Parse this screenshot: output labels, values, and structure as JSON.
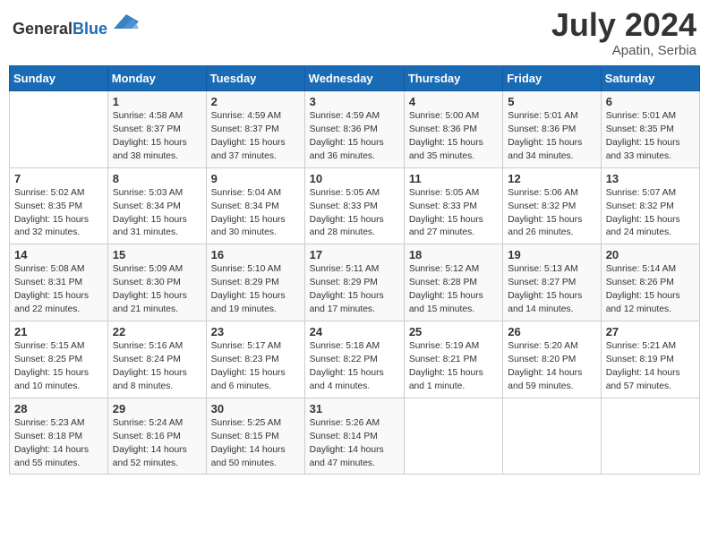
{
  "header": {
    "logo_general": "General",
    "logo_blue": "Blue",
    "month_year": "July 2024",
    "location": "Apatin, Serbia"
  },
  "days_of_week": [
    "Sunday",
    "Monday",
    "Tuesday",
    "Wednesday",
    "Thursday",
    "Friday",
    "Saturday"
  ],
  "weeks": [
    [
      {
        "day": "",
        "info": ""
      },
      {
        "day": "1",
        "info": "Sunrise: 4:58 AM\nSunset: 8:37 PM\nDaylight: 15 hours\nand 38 minutes."
      },
      {
        "day": "2",
        "info": "Sunrise: 4:59 AM\nSunset: 8:37 PM\nDaylight: 15 hours\nand 37 minutes."
      },
      {
        "day": "3",
        "info": "Sunrise: 4:59 AM\nSunset: 8:36 PM\nDaylight: 15 hours\nand 36 minutes."
      },
      {
        "day": "4",
        "info": "Sunrise: 5:00 AM\nSunset: 8:36 PM\nDaylight: 15 hours\nand 35 minutes."
      },
      {
        "day": "5",
        "info": "Sunrise: 5:01 AM\nSunset: 8:36 PM\nDaylight: 15 hours\nand 34 minutes."
      },
      {
        "day": "6",
        "info": "Sunrise: 5:01 AM\nSunset: 8:35 PM\nDaylight: 15 hours\nand 33 minutes."
      }
    ],
    [
      {
        "day": "7",
        "info": "Sunrise: 5:02 AM\nSunset: 8:35 PM\nDaylight: 15 hours\nand 32 minutes."
      },
      {
        "day": "8",
        "info": "Sunrise: 5:03 AM\nSunset: 8:34 PM\nDaylight: 15 hours\nand 31 minutes."
      },
      {
        "day": "9",
        "info": "Sunrise: 5:04 AM\nSunset: 8:34 PM\nDaylight: 15 hours\nand 30 minutes."
      },
      {
        "day": "10",
        "info": "Sunrise: 5:05 AM\nSunset: 8:33 PM\nDaylight: 15 hours\nand 28 minutes."
      },
      {
        "day": "11",
        "info": "Sunrise: 5:05 AM\nSunset: 8:33 PM\nDaylight: 15 hours\nand 27 minutes."
      },
      {
        "day": "12",
        "info": "Sunrise: 5:06 AM\nSunset: 8:32 PM\nDaylight: 15 hours\nand 26 minutes."
      },
      {
        "day": "13",
        "info": "Sunrise: 5:07 AM\nSunset: 8:32 PM\nDaylight: 15 hours\nand 24 minutes."
      }
    ],
    [
      {
        "day": "14",
        "info": "Sunrise: 5:08 AM\nSunset: 8:31 PM\nDaylight: 15 hours\nand 22 minutes."
      },
      {
        "day": "15",
        "info": "Sunrise: 5:09 AM\nSunset: 8:30 PM\nDaylight: 15 hours\nand 21 minutes."
      },
      {
        "day": "16",
        "info": "Sunrise: 5:10 AM\nSunset: 8:29 PM\nDaylight: 15 hours\nand 19 minutes."
      },
      {
        "day": "17",
        "info": "Sunrise: 5:11 AM\nSunset: 8:29 PM\nDaylight: 15 hours\nand 17 minutes."
      },
      {
        "day": "18",
        "info": "Sunrise: 5:12 AM\nSunset: 8:28 PM\nDaylight: 15 hours\nand 15 minutes."
      },
      {
        "day": "19",
        "info": "Sunrise: 5:13 AM\nSunset: 8:27 PM\nDaylight: 15 hours\nand 14 minutes."
      },
      {
        "day": "20",
        "info": "Sunrise: 5:14 AM\nSunset: 8:26 PM\nDaylight: 15 hours\nand 12 minutes."
      }
    ],
    [
      {
        "day": "21",
        "info": "Sunrise: 5:15 AM\nSunset: 8:25 PM\nDaylight: 15 hours\nand 10 minutes."
      },
      {
        "day": "22",
        "info": "Sunrise: 5:16 AM\nSunset: 8:24 PM\nDaylight: 15 hours\nand 8 minutes."
      },
      {
        "day": "23",
        "info": "Sunrise: 5:17 AM\nSunset: 8:23 PM\nDaylight: 15 hours\nand 6 minutes."
      },
      {
        "day": "24",
        "info": "Sunrise: 5:18 AM\nSunset: 8:22 PM\nDaylight: 15 hours\nand 4 minutes."
      },
      {
        "day": "25",
        "info": "Sunrise: 5:19 AM\nSunset: 8:21 PM\nDaylight: 15 hours\nand 1 minute."
      },
      {
        "day": "26",
        "info": "Sunrise: 5:20 AM\nSunset: 8:20 PM\nDaylight: 14 hours\nand 59 minutes."
      },
      {
        "day": "27",
        "info": "Sunrise: 5:21 AM\nSunset: 8:19 PM\nDaylight: 14 hours\nand 57 minutes."
      }
    ],
    [
      {
        "day": "28",
        "info": "Sunrise: 5:23 AM\nSunset: 8:18 PM\nDaylight: 14 hours\nand 55 minutes."
      },
      {
        "day": "29",
        "info": "Sunrise: 5:24 AM\nSunset: 8:16 PM\nDaylight: 14 hours\nand 52 minutes."
      },
      {
        "day": "30",
        "info": "Sunrise: 5:25 AM\nSunset: 8:15 PM\nDaylight: 14 hours\nand 50 minutes."
      },
      {
        "day": "31",
        "info": "Sunrise: 5:26 AM\nSunset: 8:14 PM\nDaylight: 14 hours\nand 47 minutes."
      },
      {
        "day": "",
        "info": ""
      },
      {
        "day": "",
        "info": ""
      },
      {
        "day": "",
        "info": ""
      }
    ]
  ]
}
